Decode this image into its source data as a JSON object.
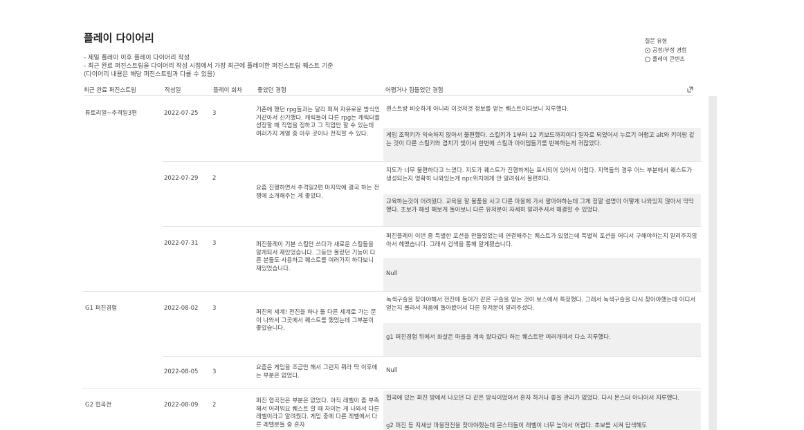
{
  "title": "플레이 다이어리",
  "notes": [
    "- 제일 플레이 이후 플레이 다이어리 작성",
    "- 최근 완료 퍼진스트림을 다이어리 작성 시점에서 가장 최근에 플레이한 퍼진스트림 퀘스트 기준",
    "(다이어리 내용은 해당 퍼진스트림과 다를 수 있음)"
  ],
  "view_option": {
    "label": "질문 유형",
    "options": [
      {
        "label": "공정/부정 경험",
        "selected": true
      },
      {
        "label": "플레이 콘텐츠",
        "selected": false
      }
    ]
  },
  "columns": {
    "stream": "최근 완료 퍼진스트림",
    "date": "작성일",
    "count": "플레이 회차",
    "good": "좋았던 경험",
    "bad": "어렵거나 힘들었던 경험"
  },
  "groups": [
    {
      "stream": "튜토리얼~추격일3편",
      "entries": [
        {
          "date": "2022-07-25",
          "count": "3",
          "good": "기존에 했던 rpg들과는 달리 퍼져 자유로운 방식인거같아서 신기했다. 캐릭들이 다른 rpg는 캐릭터를 성장할 때 직업을 정하고 그 직업만 할 수 있는데 여러가지 계열 중 아무 곳이나 전직할 수 있다.",
          "bad1": "퀀스트랑 비슷하게 아니라 이것저것 정보를 얻는 퀘스트이다보니 지루했다.",
          "bad2": "게임 조작키가 익숙하지 않아서 불편했다. 스킬키가 1부터 12 키보드까지이다 일자로 되었어서 누르기 어렵고 alt와 키이랑 같는 것이 다른 스킬키와 겹치기 빛이서 한번에 스킬과 아이템들기를 반복하는게 귀찮았다."
        },
        {
          "date": "2022-07-29",
          "count": "2",
          "good": "요즘 진행하면서 추격일2편 마지막에 결국 하는 전쟁에 소개해주는 게 좋았다.",
          "bad1": "지도가 너무 불편하다고 느꼈다. 지도가 퀘스트가 진행하게는 표시되어 있어서 어렵다. 지역들의 경우 어느 부분에서 퀘스트가 생성되는지 명확히 나와있는게 npc위치에게 안 알려줘서 불편하다.",
          "bad2": "교육하는것이 어려웠다. 교육을 할 물품을 사고 다른 마을에 가서 팔아야하는데 그게 정말 설명이 어떻게 나와있지 않아서 막막했다. 초보가 해설 해보게 돌아보니 다른 유저분이 자세히 알려주셔서 해결할 수 있었다."
        },
        {
          "date": "2022-07-31",
          "count": "3",
          "good": "퍼진플레이 기본 스킬만 쓰다가 새로운 스킬들을 알게되서 재밌었습니다. 그동안 몰랐던 기능이 다른 분들도 사용하고 퀘스트를 여러가지 하다보니 재밌었습니다.",
          "bad1": "퍼진플레이 이번 중 특별한 포션을 만들었었는데 연결해주는 퀘스트가 있었는데 특별히 포션을 어디서 구해야하는지 알려주지않아서 헤맸습니다. 그래서 검색을 통해 알게됐습니다.",
          "bad2": "Null"
        }
      ]
    },
    {
      "stream": "G1 퍼진경험",
      "entries": [
        {
          "date": "2022-08-02",
          "count": "3",
          "good": "퍼진의 세계! 전진을 하나 둘 다른 세계로 가는 문이 나와서 그곳에서 퀘스트를 했었는데 그부분이 좋았습니다.",
          "bad1": "녹색구슬을 찾아야해서 전진에 들어가 같은 구슬을 얻는 것이 보스에서 특정했다. 그래서 녹색구슬을 다시 찾아야했는데 어디서 얻는지 몰라서 처음에 돌아봤어서 다른 유저분이 알려주셨다.",
          "bad2": "g1 퍼진경험 뒤에서 화살은 마을을 계속 왔다갔다 하는 퀘스트만 여러개여서 다소 지루했다."
        },
        {
          "date": "2022-08-05",
          "count": "3",
          "good": "요즘은 게임을 조금만 해서 그런지 뭐라 딱 이후에는 부분은 없었다.",
          "bad1": "Null",
          "bad2": ""
        }
      ]
    },
    {
      "stream": "G2 협곡전",
      "entries": [
        {
          "date": "2022-08-09",
          "count": "2",
          "good": "퍼진 협곡전은 부분은 없었다. 아직 레벨이 좀 부족해서 어려워요 퀘스트 할 때 차이는 게 나와서 다른 레벨이라고 알려줬다. 게임 중에 다른 레벨에서 다른 레벨분들 중 혼자",
          "bad1": "협곡에 있는 퍼진 방에서 나오던 다 같은 방식이었어서 혼자 하거나 좋을 관리가 없었다. 다시 몬스터 아니어서 지루했다.",
          "bad2": "g2 퍼진 등 지새상 마을전전을 찾아야했는데 몬스터들이 레벨이 너무 높아서 어렵다. 초보를 시켜 탐색해도"
        }
      ]
    }
  ]
}
